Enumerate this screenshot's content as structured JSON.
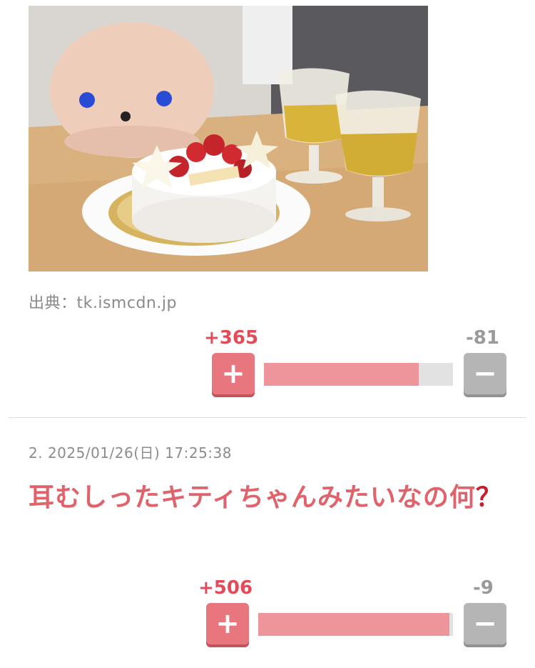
{
  "image": {
    "alt": "ケーキの写真",
    "source_label": "出典：tk.ismcdn.jp"
  },
  "vote1": {
    "plus_count": "+365",
    "minus_count": "-81",
    "plus_symbol": "+",
    "minus_symbol": "−",
    "ratio": 0.818
  },
  "post2": {
    "meta": "2. 2025/01/26(日) 17:25:38",
    "text": "耳むしったキティちゃんみたいなの何",
    "mark": "？"
  },
  "vote2": {
    "plus_count": "+506",
    "minus_count": "-9",
    "plus_symbol": "+",
    "minus_symbol": "−",
    "ratio": 0.983
  },
  "colors": {
    "accent": "#e0626b",
    "plus_button": "#e7767f",
    "minus_button": "#b5b5b5",
    "bar_fill": "#ee959b",
    "bar_bg": "#e2e2e2"
  }
}
